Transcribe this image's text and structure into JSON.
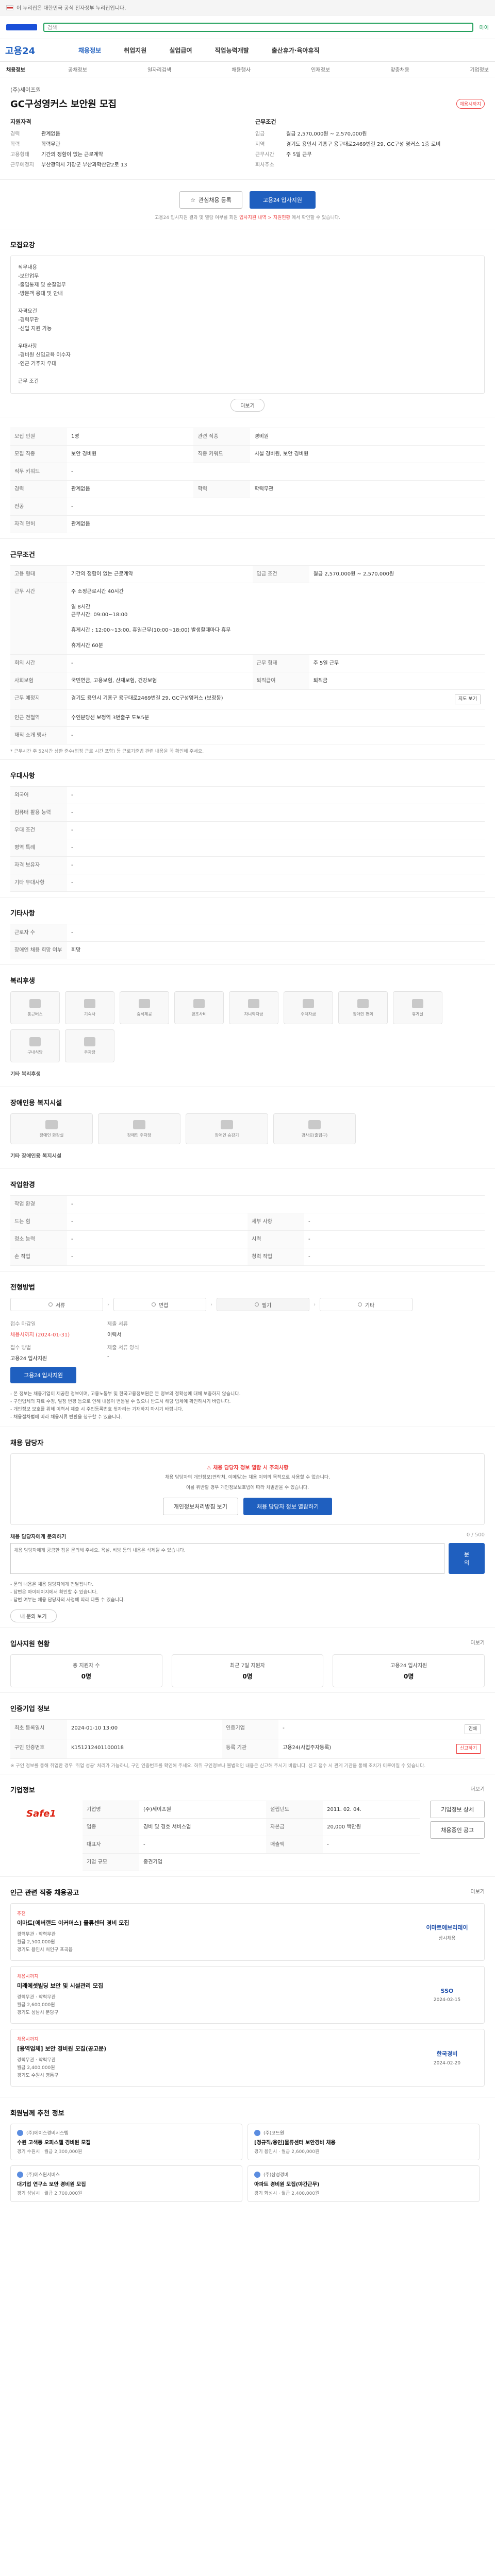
{
  "top_banner": {
    "text": "이 누리집은 대한민국 공식 전자정부 누리집입니다."
  },
  "top_strip": {
    "search_placeholder": "검색",
    "link": "마이"
  },
  "gnb": {
    "logo": "고용24",
    "menu": [
      "채용정보",
      "취업지원",
      "실업급여",
      "직업능력개발",
      "출산휴가·육아휴직"
    ]
  },
  "sub_nav": {
    "crumb": "채용정보",
    "items": [
      "공채정보",
      "일자리검색",
      "채용행사",
      "인재정보",
      "맞춤채용",
      "기업정보"
    ]
  },
  "job": {
    "company": "(주)세이프원",
    "title": "GC구성영커스 보안원 모집",
    "closing_badge": "채용시까지",
    "left_title": "지원자격",
    "left_kv": [
      {
        "k": "경력",
        "v": "관계없음"
      },
      {
        "k": "학력",
        "v": "학력무관"
      },
      {
        "k": "고용형태",
        "v": "기간의 정함이 없는 근로계약"
      },
      {
        "k": "근무예정지",
        "v": "부산광역시 기장군 부산과학산단2로 13"
      }
    ],
    "right_title": "근무조건",
    "right_kv": [
      {
        "k": "임금",
        "v": "월급 2,570,000원 ~ 2,570,000원"
      },
      {
        "k": "지역",
        "v": "경기도 용인시 기흥구 용구대로2469번길 29, GC구성 영커스 1층 로비"
      },
      {
        "k": "근무시간",
        "v": "주 5일 근무"
      },
      {
        "k": "회사주소",
        "v": ""
      }
    ],
    "scrap_label": "관심채용 등록",
    "apply_label": "고용24 입사지원",
    "note_prefix": "고용24 입사지원 결과 및 열람 여부를 회원",
    "note_red": "입사지원 내역 > 지원현황",
    "note_suffix": "에서 확인할 수 있습니다."
  },
  "detail": {
    "title": "모집요강",
    "text": "직무내용\n-보안업무\n-출입통제 및 순찰업무\n-방문객 응대 및 안내\n\n자격요건\n-경력무관\n-신입 지원 가능\n\n우대사항\n-경비원 신임교육 이수자\n-인근 거주자 우대\n\n근무 조건",
    "more_label": "더보기"
  },
  "recruit_table": {
    "rows": [
      [
        {
          "k": "모집 인원",
          "v": "1명"
        },
        {
          "k": "관련 직종",
          "v": "경비원"
        }
      ],
      [
        {
          "k": "모집 직종",
          "v": "보안 경비원"
        },
        {
          "k": "직종 키워드",
          "v": "시설 경비원, 보안 경비원"
        }
      ],
      [
        {
          "k": "직무 키워드",
          "v": "-"
        },
        {
          "k": "",
          "v": ""
        }
      ],
      [
        {
          "k": "경력",
          "v": "관계없음"
        },
        {
          "k": "학력",
          "v": "학력무관"
        }
      ],
      [
        {
          "k": "전공",
          "v": "-"
        },
        {
          "k": "",
          "v": ""
        }
      ],
      [
        {
          "k": "자격 면허",
          "v": "관계없음"
        },
        {
          "k": "",
          "v": ""
        }
      ]
    ]
  },
  "work_table": {
    "title": "근무조건",
    "rows": [
      [
        {
          "k": "고용 형태",
          "v": "기간의 정함이 없는 근로계약"
        },
        {
          "k": "임금 조건",
          "v": "월급 2,570,000원 ~ 2,570,000원"
        }
      ],
      [
        {
          "k": "근무 시간",
          "v": "주 소정근로시간 40시간\n\n일 8시간\n근무시간: 09:00~18:00\n\n휴게시간 : 12:00~13:00, 휴일근무(10:00~18:00) 발생할때마다 휴무\n\n휴게시간 60분"
        },
        {
          "k": "",
          "v": ""
        }
      ],
      [
        {
          "k": "회의 시간",
          "v": "-"
        },
        {
          "k": "근무 형태",
          "v": "주 5일 근무"
        }
      ],
      [
        {
          "k": "사회보험",
          "v": "국민연금, 고용보험, 산재보험, 건강보험"
        },
        {
          "k": "퇴직급여",
          "v": "퇴직금"
        }
      ],
      [
        {
          "k": "근무 예정지",
          "v": "경기도 용인시 기흥구 용구대로2469번길 29, GC구성영커스 (보정동)"
        },
        {
          "k": "",
          "v": ""
        }
      ],
      [
        {
          "k": "인근 전철역",
          "v": "수인분당선 보정역 3번출구 도보5분"
        },
        {
          "k": "",
          "v": ""
        }
      ],
      [
        {
          "k": "재직 소개 맹사",
          "v": "-"
        },
        {
          "k": "",
          "v": ""
        }
      ]
    ],
    "map_label": "지도 보기",
    "note": "* 근무시간 주 52시간 상한 준수(법정 근로 시간 포함) 등 근로기준법 관련 내용을 꼭 확인해 주세요."
  },
  "extra_table": {
    "title": "우대사항",
    "rows": [
      {
        "k": "외국어",
        "v": "-"
      },
      {
        "k": "컴퓨터 활용 능력",
        "v": "-"
      },
      {
        "k": "우대 조건",
        "v": "-"
      },
      {
        "k": "병역 특례",
        "v": "-"
      },
      {
        "k": "자격 보유자",
        "v": "-"
      },
      {
        "k": "기타 우대사항",
        "v": "-"
      }
    ]
  },
  "etc_table": {
    "title": "기타사항",
    "rows": [
      {
        "k": "근로자 수",
        "v": "-"
      },
      {
        "k": "장애인 채용 희망 여부",
        "v": "희망"
      }
    ]
  },
  "welfare": {
    "title": "복리후생",
    "icons": [
      "통근버스",
      "기숙사",
      "중식제공",
      "경조사비",
      "자녀학자금",
      "주택자금",
      "장애인 편의",
      "휴게실",
      "구내식당",
      "주차장"
    ],
    "other_label": "기타 복리후생"
  },
  "disability": {
    "title": "장애인용 복지시설",
    "icons": [
      "장애인 화장실",
      "장애인 주차장",
      "장애인 승강기",
      "경사로(출입구)"
    ],
    "other_label": "기타 장애인용 복지시설"
  },
  "env_table": {
    "title": "작업환경",
    "rows": [
      [
        {
          "k": "작업 환경",
          "v": "-"
        },
        {
          "k": "",
          "v": ""
        }
      ],
      [
        {
          "k": "드는 힘",
          "v": "-"
        },
        {
          "k": "세부 사항",
          "v": "-"
        }
      ],
      [
        {
          "k": "청소 능력",
          "v": "-"
        },
        {
          "k": "시력",
          "v": "-"
        }
      ],
      [
        {
          "k": "손 작업",
          "v": "-"
        },
        {
          "k": "청력 작업",
          "v": "-"
        }
      ]
    ]
  },
  "process": {
    "title": "전형방법",
    "steps": [
      "서류",
      "면접",
      "필기",
      "기타"
    ],
    "apply_lbl": "접수 마감일",
    "apply_val": "채용시까지 (2024-01-31)",
    "method_lbl": "접수 방법",
    "method_val": "고용24 입사지원",
    "doc_lbl": "제출 서류",
    "doc_val": "이력서",
    "contact_lbl": "제출 서류 양식",
    "contact_val": "-",
    "apply_btn": "고용24 입사지원",
    "bullets": [
      "- 본 정보는 채용기업이 제공한 정보이며, 고용노동부 및 한국고용정보원은 본 정보의 정확성에 대해 보증하지 않습니다.",
      "- 구인업체의 자료 수정, 일정 변경 등으로 인해 내용이 변동될 수 있으니 반드시 해당 업체에 확인하시기 바랍니다.",
      "- 개인정보 보호를 위해 이력서 제출 시 주민등록번호 뒷자리는 기재하지 마시기 바랍니다.",
      "- 채용절차법에 따라 채용서류 반환을 청구할 수 있습니다."
    ]
  },
  "rep": {
    "title": "채용 담당자",
    "warn": "채용 담당자 정보 열람 시 주의사항",
    "p1": "채용 담당자의 개인정보(연락처, 이메일)는 채용 이외의 목적으로 사용할 수 없습니다.",
    "p2": "이를 위반할 경우 개인정보보호법에 따라 처벌받을 수 있습니다.",
    "btn1": "개인정보처리방침 보기",
    "btn2": "채용 담당자 정보 열람하기",
    "qa_label": "채용 담당자에게 문의하기",
    "qa_count": "0 / 500",
    "qa_placeholder": "채용 담당자에게 궁금한 점을 문의해 주세요. 욕설, 비방 등의 내용은 삭제될 수 있습니다.",
    "qa_btn": "문의",
    "q_notes": [
      "- 문의 내용은 채용 담당자에게 전달됩니다.",
      "- 답변은 마이페이지에서 확인할 수 있습니다.",
      "- 답변 여부는 채용 담당자의 사정에 따라 다를 수 있습니다."
    ],
    "q_btn": "내 문의 보기"
  },
  "status": {
    "title": "입사지원 현황",
    "more": "더보기",
    "cards": [
      {
        "label": "총 지원자 수",
        "val": "0명"
      },
      {
        "label": "최근 7일 지원자",
        "val": "0명"
      },
      {
        "label": "고용24 입사지원",
        "val": "0명"
      }
    ]
  },
  "reg_info": {
    "title": "인증기업 정보",
    "rows": [
      [
        {
          "k": "최초 등록일시",
          "v": "2024-01-10 13:00"
        },
        {
          "k": "인증기업",
          "v": "-"
        }
      ],
      [
        {
          "k": "구인 인증번호",
          "v": "K151212401100018"
        },
        {
          "k": "등록 기관",
          "v": "고용24(사업주자등록)"
        }
      ]
    ],
    "print_btn": "인쇄",
    "report_btn": "신고하기",
    "note": "※ 구인 정보를 통해 취업한 경우 '취업 성공' 처리가 가능하니, 구인 인증번호를 확인해 주세요. 허위 구인정보나 불법적인 내용은 신고해 주시기 바랍니다. 신고 접수 시 관계 기관을 통해 조치가 이루어질 수 있습니다."
  },
  "company_info": {
    "title": "기업정보",
    "more": "더보기",
    "logo": "Safe1",
    "rows": [
      [
        {
          "k": "기업명",
          "v": "(주)세이프원"
        },
        {
          "k": "설립년도",
          "v": "2011. 02. 04."
        }
      ],
      [
        {
          "k": "업종",
          "v": "경비 및 경호 서비스업"
        },
        {
          "k": "자본금",
          "v": "20,000 백만원"
        }
      ],
      [
        {
          "k": "대표자",
          "v": "-"
        },
        {
          "k": "매출액",
          "v": "-"
        }
      ],
      [
        {
          "k": "기업 규모",
          "v": "중견기업"
        },
        {
          "k": "",
          "v": ""
        }
      ]
    ],
    "btn_info": "기업정보 상세",
    "btn_list": "채용중인 공고"
  },
  "similar": {
    "title": "인근 관련 직종 채용공고",
    "more": "더보기",
    "cards": [
      {
        "tag": "추천",
        "title": "이마트[에버랜드 이커머스] 물류센터 경비 모집",
        "meta": [
          "경력무관 · 학력무관",
          "월급 2,500,000원",
          "경기도 용인시 처인구 포곡읍"
        ],
        "logo": "이마트에브리데이",
        "dday": "상시채용"
      },
      {
        "tag": "채용시까지",
        "title": "미래에셋빌딩 보안 및 시설관리 모집",
        "meta": [
          "경력무관 · 학력무관",
          "월급 2,600,000원",
          "경기도 성남시 분당구"
        ],
        "logo": "SSO",
        "dday": "2024-02-15"
      },
      {
        "tag": "채용시까지",
        "title": "[용역업체] 보안 경비원 모집(공고문)",
        "meta": [
          "경력무관 · 학력무관",
          "월급 2,400,000원",
          "경기도 수원시 영통구"
        ],
        "logo": "한국경비",
        "dday": "2024-02-20"
      }
    ]
  },
  "recommend": {
    "title": "회원님께 추천 정보",
    "cards": [
      {
        "co": "(주)에이스경비시스템",
        "title": "수원 고색동 오피스텔 경비원 모집",
        "meta": "경기 수원시 · 월급 2,300,000원"
      },
      {
        "co": "(주)코드원",
        "title": "[정규직/용인]물류센터 보안경비 채용",
        "meta": "경기 용인시 · 월급 2,600,000원"
      },
      {
        "co": "(주)에스원서비스",
        "title": "대기업 연구소 보안 경비원 모집",
        "meta": "경기 성남시 · 월급 2,700,000원"
      },
      {
        "co": "(주)삼성경비",
        "title": "아파트 경비원 모집(야간근무)",
        "meta": "경기 화성시 · 월급 2,400,000원"
      }
    ]
  }
}
